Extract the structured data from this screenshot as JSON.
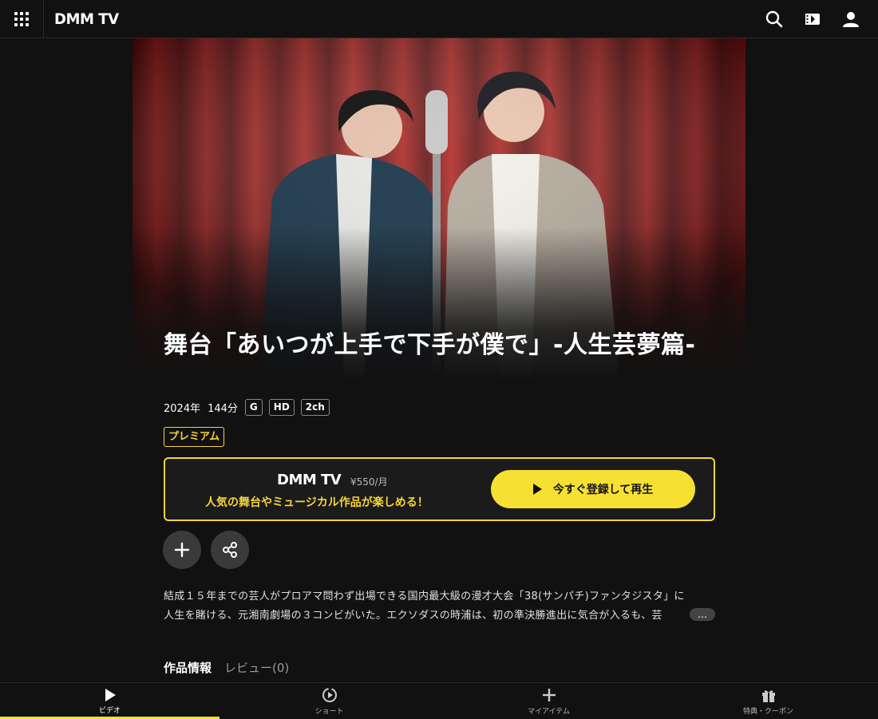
{
  "header": {
    "logo": "DMM TV",
    "icons": [
      "apps-grid-icon",
      "search-icon",
      "clapperboard-icon",
      "account-icon"
    ]
  },
  "hero": {
    "image_alt": "Two performers standing at a vintage microphone in front of a red stage curtain"
  },
  "title": "舞台「あいつが上手で下手が僕で」-人生芸夢篇-",
  "meta": {
    "year": "2024年",
    "duration": "144分",
    "tags": [
      "G",
      "HD",
      "2ch"
    ]
  },
  "badge": "プレミアム",
  "promo": {
    "logo": "DMM TV",
    "price": "¥550/月",
    "copy": "人気の舞台やミュージカル作品が楽しめる！",
    "button": "今すぐ登録して再生",
    "accent": "#f6e132"
  },
  "actions": [
    "add-icon",
    "share-icon"
  ],
  "description": {
    "line1": "結成１５年までの芸人がプロアマ問わず出場できる国内最大級の漫才大会「38(サンパチ)ファンタジスタ」に",
    "line2": "人生を賭ける、元湘南劇場の３コンビがいた。エクソダスの時浦は、初の準決勝進出に気合が入るも、芸",
    "more": "…"
  },
  "tabs": [
    {
      "label": "作品情報",
      "active": true
    },
    {
      "label": "レビュー(0)",
      "active": false
    }
  ],
  "bottom_nav": [
    {
      "label": "ビデオ",
      "icon": "play-icon",
      "active": true
    },
    {
      "label": "ショート",
      "icon": "short-video-icon",
      "active": false
    },
    {
      "label": "マイアイテム",
      "icon": "plus-icon",
      "active": false
    },
    {
      "label": "特典・クーポン",
      "icon": "gift-icon",
      "active": false
    }
  ]
}
